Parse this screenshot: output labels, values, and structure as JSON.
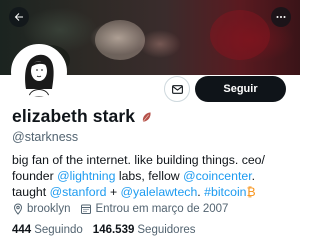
{
  "profile": {
    "display_name": "elizabeth stark",
    "handle": "@starkness",
    "follow_label": "Seguir",
    "bio": {
      "t1": "big fan of the internet. like building things. ceo/ founder ",
      "l1": "@lightning",
      "t2": " labs, fellow ",
      "l2": "@coincenter",
      "t3": ". taught ",
      "l3": "@stanford",
      "t4": " + ",
      "l4": "@yalelawtech",
      "t5": ". ",
      "l5": "#bitcoin",
      "emoji": "₿"
    },
    "location": "brooklyn",
    "joined": "Entrou em março de 2007",
    "following_count": "444",
    "following_label": "Seguindo",
    "followers_count": "146.539",
    "followers_label": "Seguidores"
  },
  "icons": {
    "back": "arrow-left-icon",
    "more": "more-dots-icon",
    "mail": "envelope-icon",
    "location": "location-pin-icon",
    "calendar": "calendar-icon",
    "name_badge": "lightning-leaf-icon"
  },
  "colors": {
    "link": "#1d9bf0",
    "follow_bg": "#0f1419",
    "muted": "#536471",
    "badge": "#b5504a"
  }
}
